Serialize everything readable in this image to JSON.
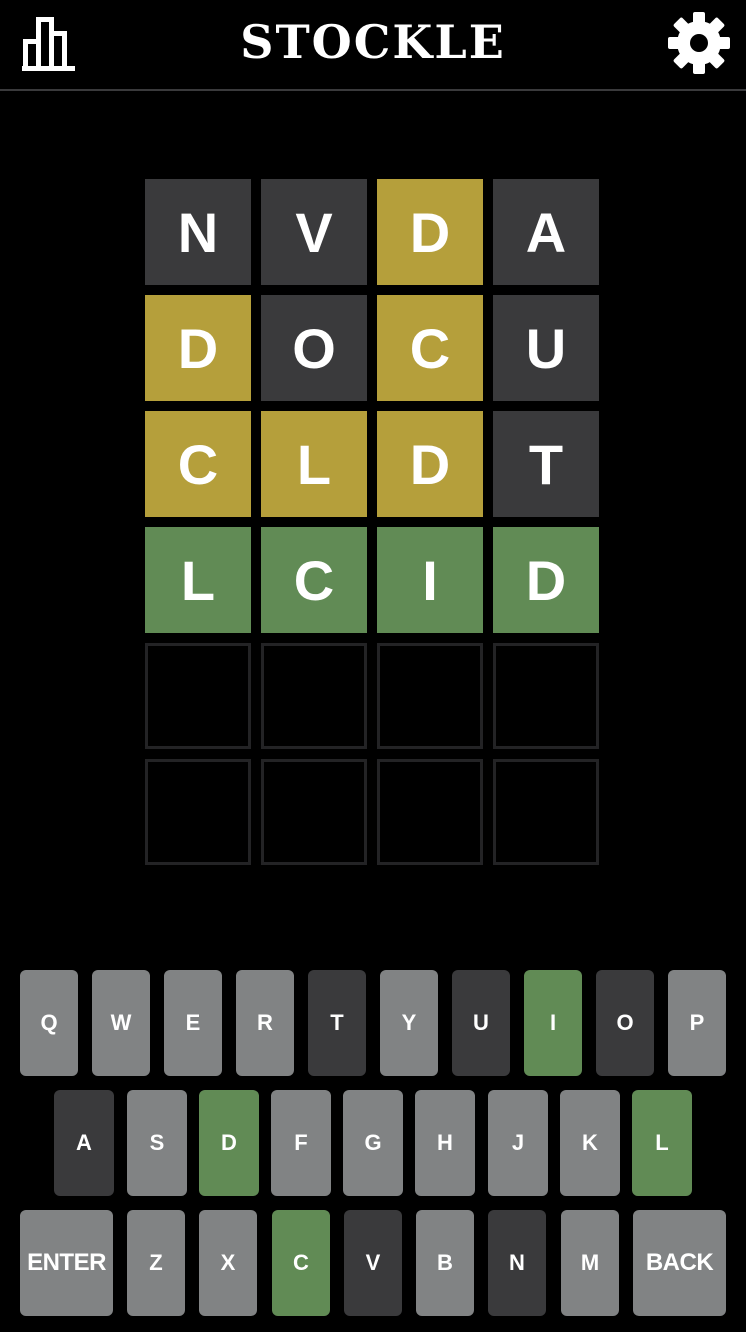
{
  "header": {
    "title": "STOCKLE"
  },
  "icons": {
    "stats": "bar-chart-icon",
    "settings": "gear-icon"
  },
  "colors": {
    "background": "#000000",
    "absent": "#3a3a3c",
    "present": "#b59f3b",
    "correct": "#618b55",
    "unused_key": "#818384",
    "empty_border": "#232325"
  },
  "board": {
    "rows": [
      [
        {
          "letter": "N",
          "state": "absent"
        },
        {
          "letter": "V",
          "state": "absent"
        },
        {
          "letter": "D",
          "state": "present"
        },
        {
          "letter": "A",
          "state": "absent"
        }
      ],
      [
        {
          "letter": "D",
          "state": "present"
        },
        {
          "letter": "O",
          "state": "absent"
        },
        {
          "letter": "C",
          "state": "present"
        },
        {
          "letter": "U",
          "state": "absent"
        }
      ],
      [
        {
          "letter": "C",
          "state": "present"
        },
        {
          "letter": "L",
          "state": "present"
        },
        {
          "letter": "D",
          "state": "present"
        },
        {
          "letter": "T",
          "state": "absent"
        }
      ],
      [
        {
          "letter": "L",
          "state": "correct"
        },
        {
          "letter": "C",
          "state": "correct"
        },
        {
          "letter": "I",
          "state": "correct"
        },
        {
          "letter": "D",
          "state": "correct"
        }
      ],
      [
        {
          "letter": "",
          "state": "empty"
        },
        {
          "letter": "",
          "state": "empty"
        },
        {
          "letter": "",
          "state": "empty"
        },
        {
          "letter": "",
          "state": "empty"
        }
      ],
      [
        {
          "letter": "",
          "state": "empty"
        },
        {
          "letter": "",
          "state": "empty"
        },
        {
          "letter": "",
          "state": "empty"
        },
        {
          "letter": "",
          "state": "empty"
        }
      ]
    ]
  },
  "keyboard": {
    "rows": [
      [
        {
          "label": "Q",
          "state": "unused"
        },
        {
          "label": "W",
          "state": "unused"
        },
        {
          "label": "E",
          "state": "unused"
        },
        {
          "label": "R",
          "state": "unused"
        },
        {
          "label": "T",
          "state": "absent"
        },
        {
          "label": "Y",
          "state": "unused"
        },
        {
          "label": "U",
          "state": "absent"
        },
        {
          "label": "I",
          "state": "correct"
        },
        {
          "label": "O",
          "state": "absent"
        },
        {
          "label": "P",
          "state": "unused"
        }
      ],
      [
        {
          "label": "A",
          "state": "absent"
        },
        {
          "label": "S",
          "state": "unused"
        },
        {
          "label": "D",
          "state": "correct"
        },
        {
          "label": "F",
          "state": "unused"
        },
        {
          "label": "G",
          "state": "unused"
        },
        {
          "label": "H",
          "state": "unused"
        },
        {
          "label": "J",
          "state": "unused"
        },
        {
          "label": "K",
          "state": "unused"
        },
        {
          "label": "L",
          "state": "correct"
        }
      ],
      [
        {
          "label": "ENTER",
          "state": "unused"
        },
        {
          "label": "Z",
          "state": "unused"
        },
        {
          "label": "X",
          "state": "unused"
        },
        {
          "label": "C",
          "state": "correct"
        },
        {
          "label": "V",
          "state": "absent"
        },
        {
          "label": "B",
          "state": "unused"
        },
        {
          "label": "N",
          "state": "absent"
        },
        {
          "label": "M",
          "state": "unused"
        },
        {
          "label": "BACK",
          "state": "unused"
        }
      ]
    ]
  }
}
